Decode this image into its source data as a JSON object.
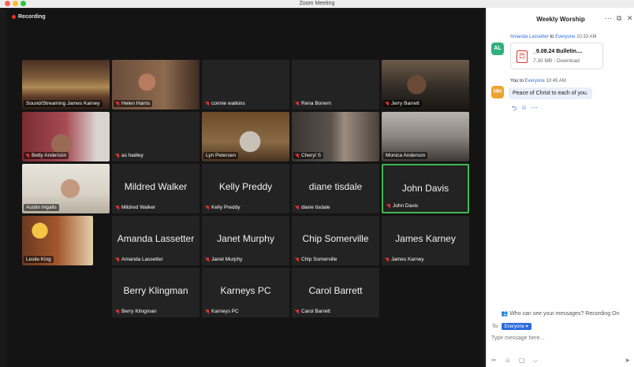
{
  "window": {
    "title": "Zoom Meeting",
    "traffic_lights": [
      "#ff5f57",
      "#febc2e",
      "#28c840"
    ]
  },
  "recording": {
    "label": "Recording",
    "color": "#e5332a"
  },
  "tiles": [
    {
      "name": "Sound/Streaming James Karney",
      "muted": false,
      "big": "",
      "scene": "church"
    },
    {
      "name": "Helen Harris",
      "muted": true,
      "big": "",
      "scene": "helen"
    },
    {
      "name": "connie watkins",
      "muted": true,
      "big": "",
      "scene": ""
    },
    {
      "name": "Rena Bonem",
      "muted": true,
      "big": "",
      "scene": ""
    },
    {
      "name": "Jerry Barrett",
      "muted": true,
      "big": "",
      "scene": "jerry"
    },
    {
      "name": "Betty Anderson",
      "muted": true,
      "big": "",
      "scene": "betty"
    },
    {
      "name": "as hadley",
      "muted": true,
      "big": "",
      "scene": ""
    },
    {
      "name": "Lyn Petersen",
      "muted": false,
      "big": "",
      "scene": "lyn"
    },
    {
      "name": "Cheryl S",
      "muted": true,
      "big": "",
      "scene": "cheryl"
    },
    {
      "name": "Monica Anderson",
      "muted": false,
      "big": "",
      "scene": "monica"
    },
    {
      "name": "Austin Ingalls",
      "muted": false,
      "big": "",
      "scene": "austin"
    },
    {
      "name": "Mildred Walker",
      "muted": true,
      "big": "Mildred Walker",
      "scene": ""
    },
    {
      "name": "Kelly Preddy",
      "muted": true,
      "big": "Kelly Preddy",
      "scene": ""
    },
    {
      "name": "diane tisdale",
      "muted": true,
      "big": "diane tisdale",
      "scene": ""
    },
    {
      "name": "John Davis",
      "muted": true,
      "big": "John Davis",
      "scene": "",
      "active": true
    },
    {
      "name": "Leslie King",
      "muted": false,
      "big": "",
      "scene": "leslie"
    },
    {
      "name": "Amanda Lassetter",
      "muted": true,
      "big": "Amanda Lassetter",
      "scene": ""
    },
    {
      "name": "Janet Murphy",
      "muted": true,
      "big": "Janet Murphy",
      "scene": ""
    },
    {
      "name": "Chip Somerville",
      "muted": true,
      "big": "Chip Somerville",
      "scene": ""
    },
    {
      "name": "James Karney",
      "muted": true,
      "big": "James Karney",
      "scene": ""
    },
    {
      "name": "Berry Klingman",
      "muted": true,
      "big": "Berry Klingman",
      "scene": ""
    },
    {
      "name": "Karneys PC",
      "muted": true,
      "big": "Karneys PC",
      "scene": ""
    },
    {
      "name": "Carol Barrett",
      "muted": true,
      "big": "Carol Barrett",
      "scene": ""
    }
  ],
  "chat": {
    "title": "Weekly Worship",
    "header_icons": [
      "more-icon",
      "popout-icon",
      "close-icon"
    ],
    "messages": [
      {
        "initials": "AL",
        "avatar_color": "#2fb07c",
        "sender": "Amanda Lassetter",
        "to_word": "to",
        "recipient": "Everyone",
        "time": "10:33 AM",
        "file_name": "_9.08.24 Bulletin....",
        "file_info": "7.30 MB - Download"
      },
      {
        "initials": "HH",
        "avatar_color": "#f0a22e",
        "sender": "You",
        "to_word": "to",
        "recipient": "Everyone",
        "time": "10:45 AM",
        "text": "Peace of Christ to each of you."
      }
    ],
    "privacy_note": "Who can see your messages? Recording On",
    "to_label": "To:",
    "to_value": "Everyone ▾",
    "input_placeholder": "Type message here...",
    "toolbar_icons": [
      "screenshot-icon",
      "emoji-icon",
      "file-icon",
      "more-icon",
      "send-icon"
    ]
  }
}
